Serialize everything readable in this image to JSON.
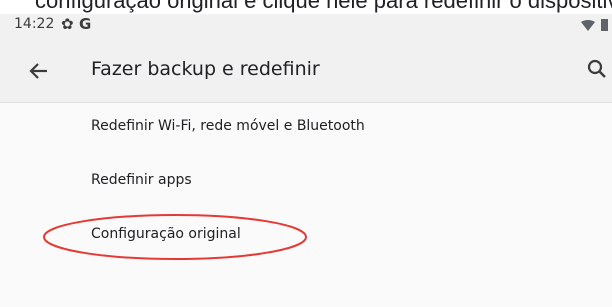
{
  "caption": {
    "text": "configuração original e clique nele para redefinir o dispositivo"
  },
  "status_bar": {
    "time": "14:22",
    "gear_icon": "gear-icon",
    "notification_letter": "G",
    "wifi_icon": "wifi-icon",
    "battery_icon": "battery-icon"
  },
  "toolbar": {
    "back_icon": "arrow-left-icon",
    "title": "Fazer backup e redefinir",
    "search_icon": "search-icon"
  },
  "menu": {
    "items": [
      {
        "label": "Redefinir Wi-Fi, rede móvel e Bluetooth"
      },
      {
        "label": "Redefinir apps"
      },
      {
        "label": "Configuração original"
      }
    ]
  },
  "annotation": {
    "type": "ellipse",
    "color": "#e53935",
    "highlights": "Configuração original"
  },
  "colors": {
    "background": "#fafafa",
    "toolbar": "#f1f1f1",
    "text": "#202124",
    "annotation": "#e53935"
  }
}
